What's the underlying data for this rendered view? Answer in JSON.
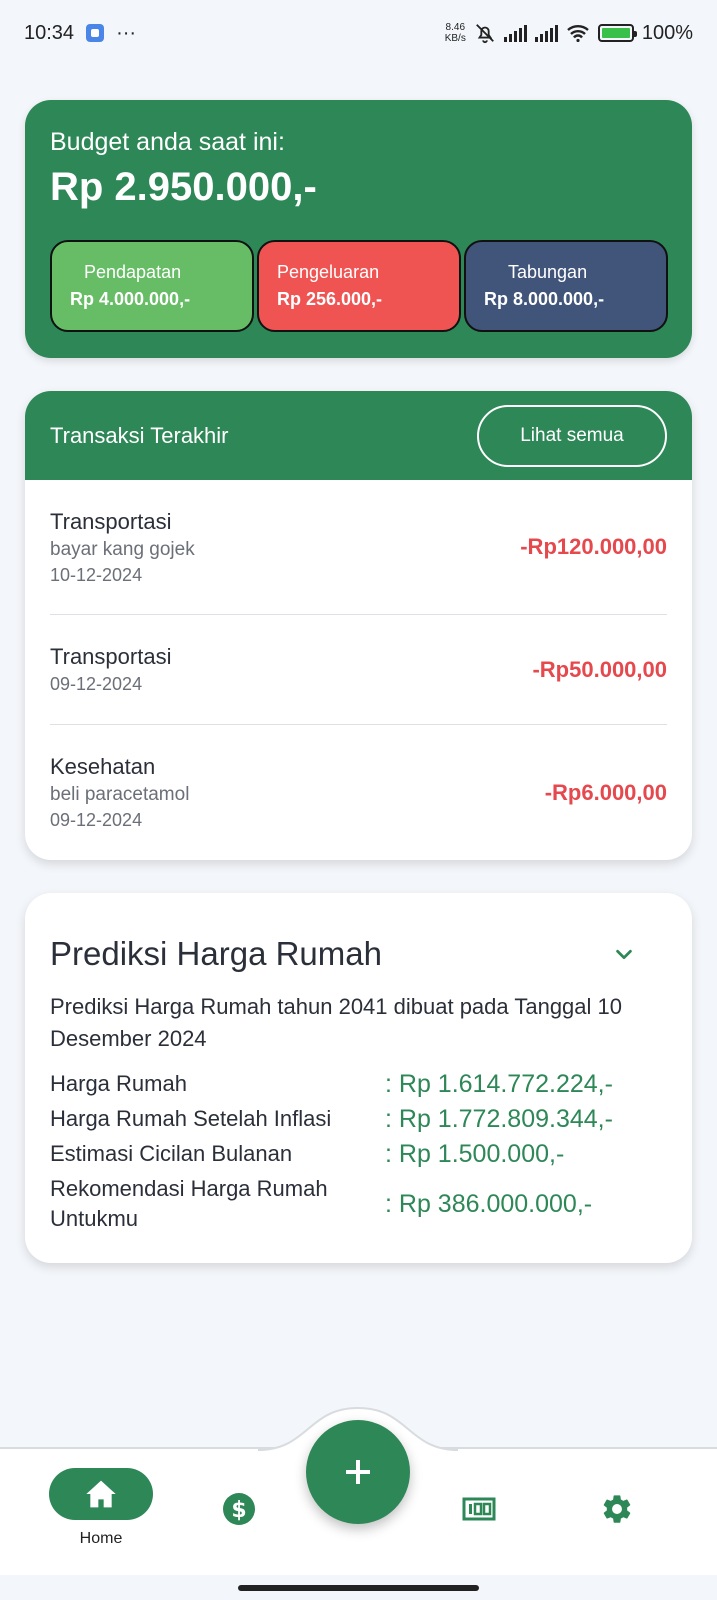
{
  "status_bar": {
    "time": "10:34",
    "dots": "···",
    "speed_top": "8.46",
    "speed_bottom": "KB/s",
    "battery": "100%"
  },
  "budget": {
    "label": "Budget anda saat ini:",
    "value": "Rp 2.950.000,-",
    "income_label": "Pendapatan",
    "income_value": "Rp 4.000.000,-",
    "expense_label": "Pengeluaran",
    "expense_value": "Rp 256.000,-",
    "saving_label": "Tabungan",
    "saving_value": "Rp 8.000.000,-",
    "colors": {
      "card": "#2e8757",
      "income": "#67bd65",
      "expense": "#ef5453",
      "saving": "#415479"
    }
  },
  "transactions": {
    "title": "Transaksi Terakhir",
    "see_all": "Lihat semua",
    "items": [
      {
        "category": "Transportasi",
        "note": "bayar kang gojek",
        "date": "10-12-2024",
        "amount": "-Rp120.000,00"
      },
      {
        "category": "Transportasi",
        "note": "",
        "date": "09-12-2024",
        "amount": "-Rp50.000,00"
      },
      {
        "category": "Kesehatan",
        "note": "beli paracetamol",
        "date": "09-12-2024",
        "amount": "-Rp6.000,00"
      }
    ]
  },
  "prediction": {
    "title": "Prediksi Harga Rumah",
    "description": "Prediksi Harga Rumah tahun 2041 dibuat pada Tanggal 10 Desember 2024",
    "rows": [
      {
        "label": "Harga Rumah",
        "value": ": Rp 1.614.772.224,-"
      },
      {
        "label": "Harga Rumah Setelah Inflasi",
        "value": ": Rp 1.772.809.344,-"
      },
      {
        "label": "Estimasi Cicilan Bulanan",
        "value": ": Rp 1.500.000,-"
      },
      {
        "label": "Rekomendasi Harga Rumah Untukmu",
        "value": ": Rp 386.000.000,-"
      }
    ]
  },
  "nav": {
    "home_label": "Home",
    "fab_symbol": "+",
    "icons": [
      "home-icon",
      "dollar-icon",
      "add-icon",
      "budget-icon",
      "settings-icon"
    ]
  }
}
